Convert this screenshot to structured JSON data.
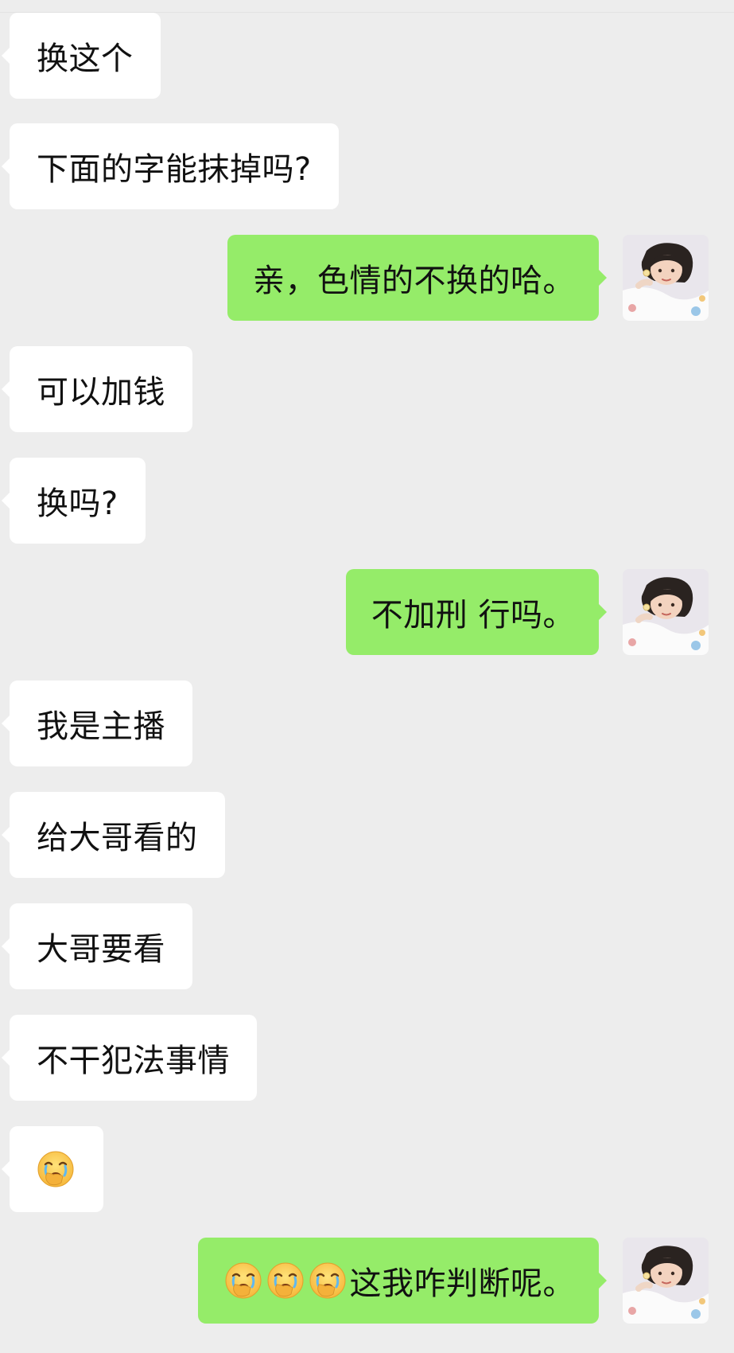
{
  "messages": [
    {
      "side": "in",
      "text": "换这个"
    },
    {
      "side": "in",
      "text": "下面的字能抹掉吗?"
    },
    {
      "side": "out",
      "text": "亲，色情的不换的哈。"
    },
    {
      "side": "in",
      "text": "可以加钱"
    },
    {
      "side": "in",
      "text": "换吗?"
    },
    {
      "side": "out",
      "text": "不加刑 行吗。"
    },
    {
      "side": "in",
      "text": "我是主播"
    },
    {
      "side": "in",
      "text": "给大哥看的"
    },
    {
      "side": "in",
      "text": "大哥要看"
    },
    {
      "side": "in",
      "text": "不干犯法事情"
    },
    {
      "side": "in",
      "text": "",
      "emoji": [
        "facepalm-emoji"
      ]
    },
    {
      "side": "out",
      "text": "这我咋判断呢。",
      "emoji": [
        "facepalm-emoji",
        "facepalm-emoji",
        "facepalm-emoji"
      ]
    }
  ],
  "colors": {
    "background": "#EDEDED",
    "incoming_bubble": "#FFFFFF",
    "outgoing_bubble": "#95EC69",
    "text": "#111111"
  }
}
